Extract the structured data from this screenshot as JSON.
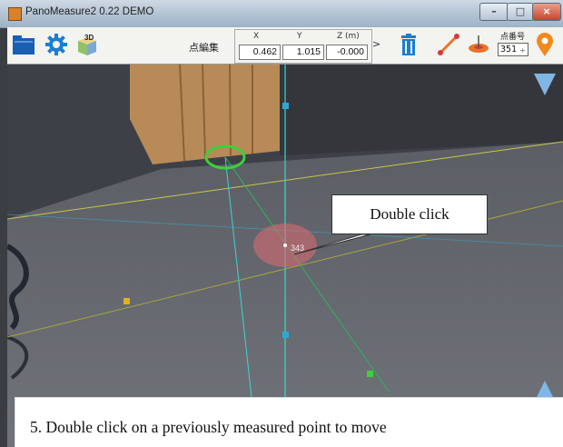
{
  "window": {
    "title": "PanoMeasure2 0.22 DEMO",
    "close_glyph": "×"
  },
  "toolbar": {
    "edit_label": "点編集",
    "x_label": "X",
    "y_label": "Y",
    "z_label": "Z (m)",
    "x_value": "0.462",
    "y_value": "1.015",
    "z_value": "-0.000",
    "next_label": ">",
    "point_no_label": "点番号",
    "point_no_value": "351",
    "spin_glyph": "÷"
  },
  "icons": [
    "folder-icon",
    "gear-icon",
    "3d-cube-icon",
    "trash-icon",
    "line-measure-icon",
    "level-icon",
    "location-pin-icon",
    "triangle-down-icon",
    "triangle-up-icon"
  ],
  "scene": {
    "point_label": "343"
  },
  "callout": {
    "text": "Double click"
  },
  "caption": {
    "text": "5. Double click on a previously measured point to move"
  },
  "colors": {
    "accent_blue": "#1a5fb4",
    "pin_orange": "#f08a1c",
    "nav_blue": "#7fb6e6",
    "selected_point": "#e06a72",
    "green_guide": "#3cd13c"
  }
}
